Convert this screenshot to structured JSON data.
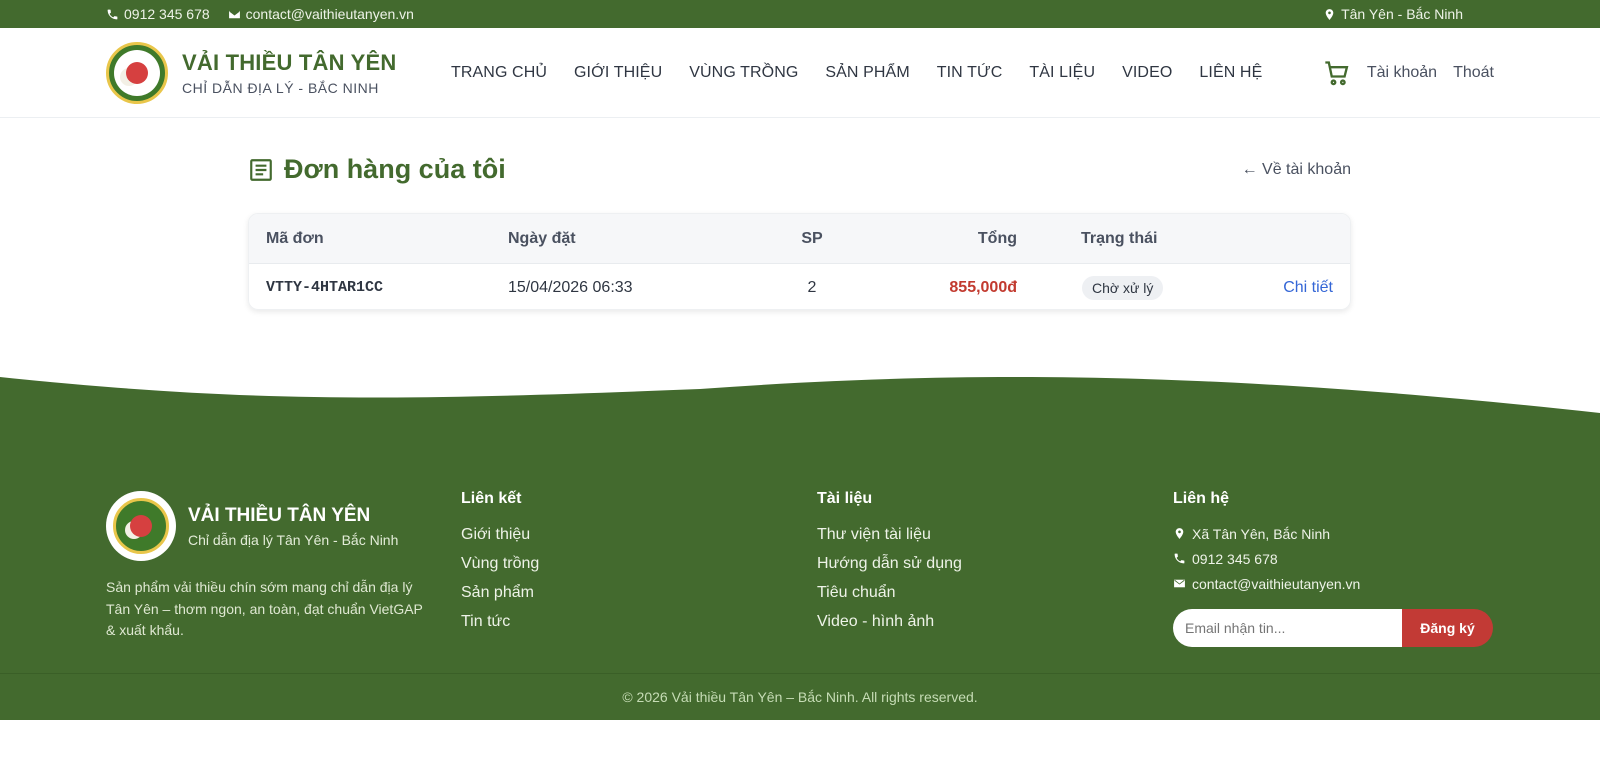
{
  "topbar": {
    "phone": "0912 345 678",
    "email": "contact@vaithieutanyen.vn",
    "location": "Tân Yên - Bắc Ninh"
  },
  "brand": {
    "title": "VẢI THIỀU TÂN YÊN",
    "subtitle": "CHỈ DẪN ĐỊA LÝ - BẮC NINH"
  },
  "nav": [
    "TRANG CHỦ",
    "GIỚI THIỆU",
    "VÙNG TRỒNG",
    "SẢN PHẨM",
    "TIN TỨC",
    "TÀI LIỆU",
    "VIDEO",
    "LIÊN HỆ"
  ],
  "account": {
    "account_label": "Tài khoản",
    "logout_label": "Thoát"
  },
  "page": {
    "title": "Đơn hàng của tôi",
    "back_link": "← Về tài khoản"
  },
  "orders": {
    "headers": [
      "Mã đơn",
      "Ngày đặt",
      "SP",
      "Tổng",
      "Trạng thái"
    ],
    "rows": [
      {
        "code": "VTTY-4HTAR1CC",
        "date": "15/04/2026 06:33",
        "items": "2",
        "total": "855,000đ",
        "status": "Chờ xử lý",
        "action": "Chi tiết"
      }
    ]
  },
  "footer": {
    "brand_title": "VẢI THIỀU TÂN YÊN",
    "brand_subtitle": "Chỉ dẫn địa lý Tân Yên - Bắc Ninh",
    "description": "Sản phẩm vải thiều chín sớm mang chỉ dẫn địa lý Tân Yên – thơm ngon, an toàn, đạt chuẩn VietGAP & xuất khẩu.",
    "links_heading": "Liên kết",
    "links": [
      "Giới thiệu",
      "Vùng trồng",
      "Sản phẩm",
      "Tin tức"
    ],
    "docs_heading": "Tài liệu",
    "docs": [
      "Thư viện tài liệu",
      "Hướng dẫn sử dụng",
      "Tiêu chuẩn",
      "Video - hình ảnh"
    ],
    "contact_heading": "Liên hệ",
    "address": "Xã Tân Yên, Bắc Ninh",
    "phone": "0912 345 678",
    "email": "contact@vaithieutanyen.vn",
    "newsletter_placeholder": "Email nhận tin...",
    "subscribe_label": "Đăng ký",
    "copyright": "© 2026 Vải thiều Tân Yên – Bắc Ninh. All rights reserved."
  },
  "colors": {
    "primary": "#436a2e",
    "accent_red": "#c23a35",
    "link_blue": "#3466d6"
  }
}
